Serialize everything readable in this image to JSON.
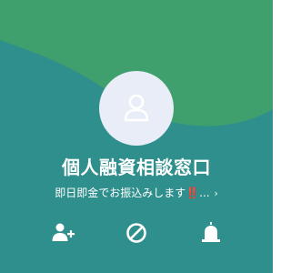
{
  "profile": {
    "name": "個人融資相談窓口",
    "status_message": "即日即金でお振込みします‼️...",
    "chevron": "›"
  },
  "actions": [
    {
      "icon": "add-friend-icon"
    },
    {
      "icon": "block-icon"
    },
    {
      "icon": "report-icon"
    }
  ],
  "colors": {
    "background": "#2f8f8c",
    "blob": "#3f9f6d",
    "avatar_bg": "#e9edf7",
    "avatar_icon": "#ffffff",
    "text": "#ffffff"
  }
}
